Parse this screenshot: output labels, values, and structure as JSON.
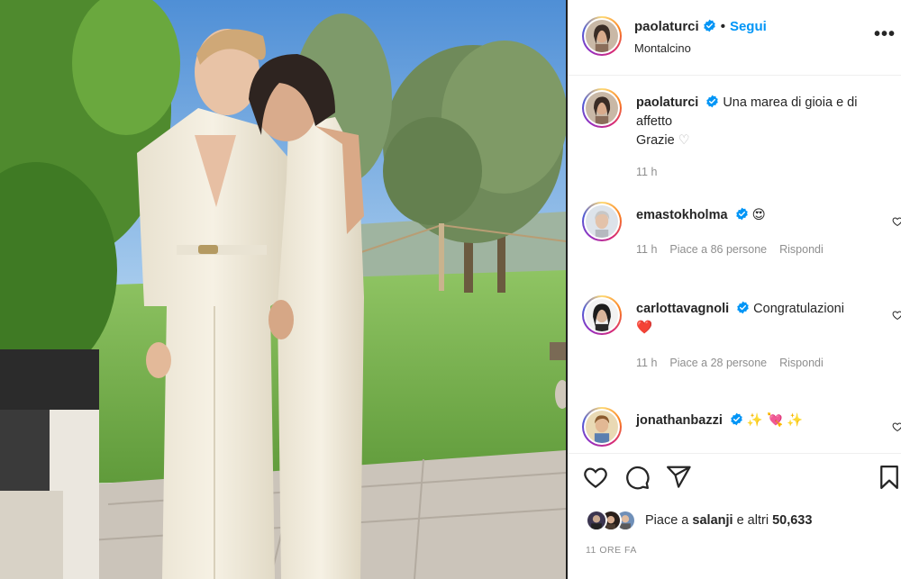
{
  "post": {
    "username": "paolaturci",
    "separator": "•",
    "follow_label": "Segui",
    "location": "Montalcino",
    "more_label": "•••"
  },
  "caption": {
    "username": "paolaturci",
    "text_line1": "Una marea di gioia e di",
    "text_line2": "affetto",
    "text_line3": "Grazie",
    "heart_glyph": "♡",
    "time": "11 h"
  },
  "comments": [
    {
      "username": "emastokholma",
      "text": "😍",
      "time": "11 h",
      "likes": "Piace a 86 persone",
      "reply": "Rispondi"
    },
    {
      "username": "carlottavagnoli",
      "text": "Congratulazioni",
      "text2": "❤️",
      "time": "11 h",
      "likes": "Piace a 28 persone",
      "reply": "Rispondi"
    },
    {
      "username": "jonathanbazzi",
      "text": "✨ 💘 ✨"
    }
  ],
  "likes_line": {
    "prefix": "Piace a",
    "user": "salanji",
    "connector": "e altri",
    "count": "50,633"
  },
  "timestamp": "11 ORE FA",
  "colors": {
    "accent": "#0095f6",
    "verified": "#0095f6",
    "text": "#262626",
    "secondary": "#8e8e8e",
    "heart_red": "#ed4956"
  },
  "icons": [
    "verified-badge-icon",
    "heart-icon",
    "comment-icon",
    "share-icon",
    "bookmark-icon",
    "more-icon"
  ]
}
